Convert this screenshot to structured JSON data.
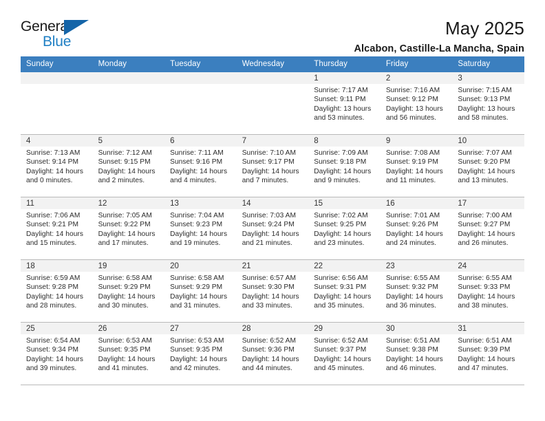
{
  "brand": {
    "name_part1": "General",
    "name_part2": "Blue",
    "logo_icon": "blue-triangle-icon"
  },
  "header": {
    "title": "May 2025",
    "subtitle": "Alcabon, Castille-La Mancha, Spain"
  },
  "colors": {
    "header_blue": "#3b7fbf",
    "brand_blue": "#1f7fc4",
    "logo_blue": "#1565a8",
    "date_bar_gray": "#f2f2f2",
    "cell_border": "#b9b9b9"
  },
  "weekday_headers": [
    "Sunday",
    "Monday",
    "Tuesday",
    "Wednesday",
    "Thursday",
    "Friday",
    "Saturday"
  ],
  "weeks": [
    [
      {
        "date": "",
        "empty": true,
        "sunrise": "",
        "sunset": "",
        "daylight_line1": "",
        "daylight_line2": ""
      },
      {
        "date": "",
        "empty": true,
        "sunrise": "",
        "sunset": "",
        "daylight_line1": "",
        "daylight_line2": ""
      },
      {
        "date": "",
        "empty": true,
        "sunrise": "",
        "sunset": "",
        "daylight_line1": "",
        "daylight_line2": ""
      },
      {
        "date": "",
        "empty": true,
        "sunrise": "",
        "sunset": "",
        "daylight_line1": "",
        "daylight_line2": ""
      },
      {
        "date": "1",
        "empty": false,
        "sunrise": "Sunrise: 7:17 AM",
        "sunset": "Sunset: 9:11 PM",
        "daylight_line1": "Daylight: 13 hours",
        "daylight_line2": "and 53 minutes."
      },
      {
        "date": "2",
        "empty": false,
        "sunrise": "Sunrise: 7:16 AM",
        "sunset": "Sunset: 9:12 PM",
        "daylight_line1": "Daylight: 13 hours",
        "daylight_line2": "and 56 minutes."
      },
      {
        "date": "3",
        "empty": false,
        "sunrise": "Sunrise: 7:15 AM",
        "sunset": "Sunset: 9:13 PM",
        "daylight_line1": "Daylight: 13 hours",
        "daylight_line2": "and 58 minutes."
      }
    ],
    [
      {
        "date": "4",
        "empty": false,
        "sunrise": "Sunrise: 7:13 AM",
        "sunset": "Sunset: 9:14 PM",
        "daylight_line1": "Daylight: 14 hours",
        "daylight_line2": "and 0 minutes."
      },
      {
        "date": "5",
        "empty": false,
        "sunrise": "Sunrise: 7:12 AM",
        "sunset": "Sunset: 9:15 PM",
        "daylight_line1": "Daylight: 14 hours",
        "daylight_line2": "and 2 minutes."
      },
      {
        "date": "6",
        "empty": false,
        "sunrise": "Sunrise: 7:11 AM",
        "sunset": "Sunset: 9:16 PM",
        "daylight_line1": "Daylight: 14 hours",
        "daylight_line2": "and 4 minutes."
      },
      {
        "date": "7",
        "empty": false,
        "sunrise": "Sunrise: 7:10 AM",
        "sunset": "Sunset: 9:17 PM",
        "daylight_line1": "Daylight: 14 hours",
        "daylight_line2": "and 7 minutes."
      },
      {
        "date": "8",
        "empty": false,
        "sunrise": "Sunrise: 7:09 AM",
        "sunset": "Sunset: 9:18 PM",
        "daylight_line1": "Daylight: 14 hours",
        "daylight_line2": "and 9 minutes."
      },
      {
        "date": "9",
        "empty": false,
        "sunrise": "Sunrise: 7:08 AM",
        "sunset": "Sunset: 9:19 PM",
        "daylight_line1": "Daylight: 14 hours",
        "daylight_line2": "and 11 minutes."
      },
      {
        "date": "10",
        "empty": false,
        "sunrise": "Sunrise: 7:07 AM",
        "sunset": "Sunset: 9:20 PM",
        "daylight_line1": "Daylight: 14 hours",
        "daylight_line2": "and 13 minutes."
      }
    ],
    [
      {
        "date": "11",
        "empty": false,
        "sunrise": "Sunrise: 7:06 AM",
        "sunset": "Sunset: 9:21 PM",
        "daylight_line1": "Daylight: 14 hours",
        "daylight_line2": "and 15 minutes."
      },
      {
        "date": "12",
        "empty": false,
        "sunrise": "Sunrise: 7:05 AM",
        "sunset": "Sunset: 9:22 PM",
        "daylight_line1": "Daylight: 14 hours",
        "daylight_line2": "and 17 minutes."
      },
      {
        "date": "13",
        "empty": false,
        "sunrise": "Sunrise: 7:04 AM",
        "sunset": "Sunset: 9:23 PM",
        "daylight_line1": "Daylight: 14 hours",
        "daylight_line2": "and 19 minutes."
      },
      {
        "date": "14",
        "empty": false,
        "sunrise": "Sunrise: 7:03 AM",
        "sunset": "Sunset: 9:24 PM",
        "daylight_line1": "Daylight: 14 hours",
        "daylight_line2": "and 21 minutes."
      },
      {
        "date": "15",
        "empty": false,
        "sunrise": "Sunrise: 7:02 AM",
        "sunset": "Sunset: 9:25 PM",
        "daylight_line1": "Daylight: 14 hours",
        "daylight_line2": "and 23 minutes."
      },
      {
        "date": "16",
        "empty": false,
        "sunrise": "Sunrise: 7:01 AM",
        "sunset": "Sunset: 9:26 PM",
        "daylight_line1": "Daylight: 14 hours",
        "daylight_line2": "and 24 minutes."
      },
      {
        "date": "17",
        "empty": false,
        "sunrise": "Sunrise: 7:00 AM",
        "sunset": "Sunset: 9:27 PM",
        "daylight_line1": "Daylight: 14 hours",
        "daylight_line2": "and 26 minutes."
      }
    ],
    [
      {
        "date": "18",
        "empty": false,
        "sunrise": "Sunrise: 6:59 AM",
        "sunset": "Sunset: 9:28 PM",
        "daylight_line1": "Daylight: 14 hours",
        "daylight_line2": "and 28 minutes."
      },
      {
        "date": "19",
        "empty": false,
        "sunrise": "Sunrise: 6:58 AM",
        "sunset": "Sunset: 9:29 PM",
        "daylight_line1": "Daylight: 14 hours",
        "daylight_line2": "and 30 minutes."
      },
      {
        "date": "20",
        "empty": false,
        "sunrise": "Sunrise: 6:58 AM",
        "sunset": "Sunset: 9:29 PM",
        "daylight_line1": "Daylight: 14 hours",
        "daylight_line2": "and 31 minutes."
      },
      {
        "date": "21",
        "empty": false,
        "sunrise": "Sunrise: 6:57 AM",
        "sunset": "Sunset: 9:30 PM",
        "daylight_line1": "Daylight: 14 hours",
        "daylight_line2": "and 33 minutes."
      },
      {
        "date": "22",
        "empty": false,
        "sunrise": "Sunrise: 6:56 AM",
        "sunset": "Sunset: 9:31 PM",
        "daylight_line1": "Daylight: 14 hours",
        "daylight_line2": "and 35 minutes."
      },
      {
        "date": "23",
        "empty": false,
        "sunrise": "Sunrise: 6:55 AM",
        "sunset": "Sunset: 9:32 PM",
        "daylight_line1": "Daylight: 14 hours",
        "daylight_line2": "and 36 minutes."
      },
      {
        "date": "24",
        "empty": false,
        "sunrise": "Sunrise: 6:55 AM",
        "sunset": "Sunset: 9:33 PM",
        "daylight_line1": "Daylight: 14 hours",
        "daylight_line2": "and 38 minutes."
      }
    ],
    [
      {
        "date": "25",
        "empty": false,
        "sunrise": "Sunrise: 6:54 AM",
        "sunset": "Sunset: 9:34 PM",
        "daylight_line1": "Daylight: 14 hours",
        "daylight_line2": "and 39 minutes."
      },
      {
        "date": "26",
        "empty": false,
        "sunrise": "Sunrise: 6:53 AM",
        "sunset": "Sunset: 9:35 PM",
        "daylight_line1": "Daylight: 14 hours",
        "daylight_line2": "and 41 minutes."
      },
      {
        "date": "27",
        "empty": false,
        "sunrise": "Sunrise: 6:53 AM",
        "sunset": "Sunset: 9:35 PM",
        "daylight_line1": "Daylight: 14 hours",
        "daylight_line2": "and 42 minutes."
      },
      {
        "date": "28",
        "empty": false,
        "sunrise": "Sunrise: 6:52 AM",
        "sunset": "Sunset: 9:36 PM",
        "daylight_line1": "Daylight: 14 hours",
        "daylight_line2": "and 44 minutes."
      },
      {
        "date": "29",
        "empty": false,
        "sunrise": "Sunrise: 6:52 AM",
        "sunset": "Sunset: 9:37 PM",
        "daylight_line1": "Daylight: 14 hours",
        "daylight_line2": "and 45 minutes."
      },
      {
        "date": "30",
        "empty": false,
        "sunrise": "Sunrise: 6:51 AM",
        "sunset": "Sunset: 9:38 PM",
        "daylight_line1": "Daylight: 14 hours",
        "daylight_line2": "and 46 minutes."
      },
      {
        "date": "31",
        "empty": false,
        "sunrise": "Sunrise: 6:51 AM",
        "sunset": "Sunset: 9:39 PM",
        "daylight_line1": "Daylight: 14 hours",
        "daylight_line2": "and 47 minutes."
      }
    ]
  ]
}
